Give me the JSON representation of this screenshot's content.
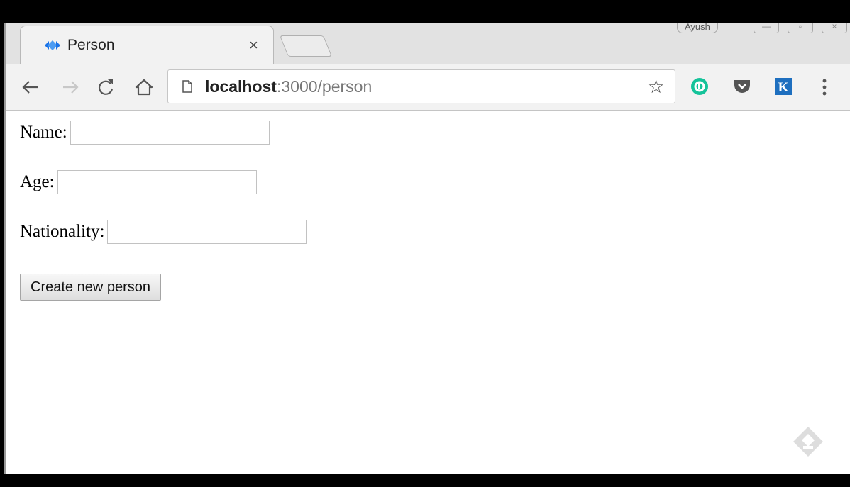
{
  "browser": {
    "tab": {
      "title": "Person",
      "favicon": "diamond-arrows-icon",
      "close": "×"
    },
    "profile_name": "Ayush",
    "address": {
      "host": "localhost",
      "rest": ":3000/person"
    },
    "extensions": [
      "grammarly-icon",
      "pocket-icon",
      "k-icon"
    ],
    "colors": {
      "grammarly": "#15c39a",
      "pocket": "#555555",
      "k": "#1e6fbf"
    }
  },
  "form": {
    "name_label": "Name:",
    "age_label": "Age:",
    "nationality_label": "Nationality:",
    "name_value": "",
    "age_value": "",
    "nationality_value": "",
    "submit_label": "Create new person"
  }
}
